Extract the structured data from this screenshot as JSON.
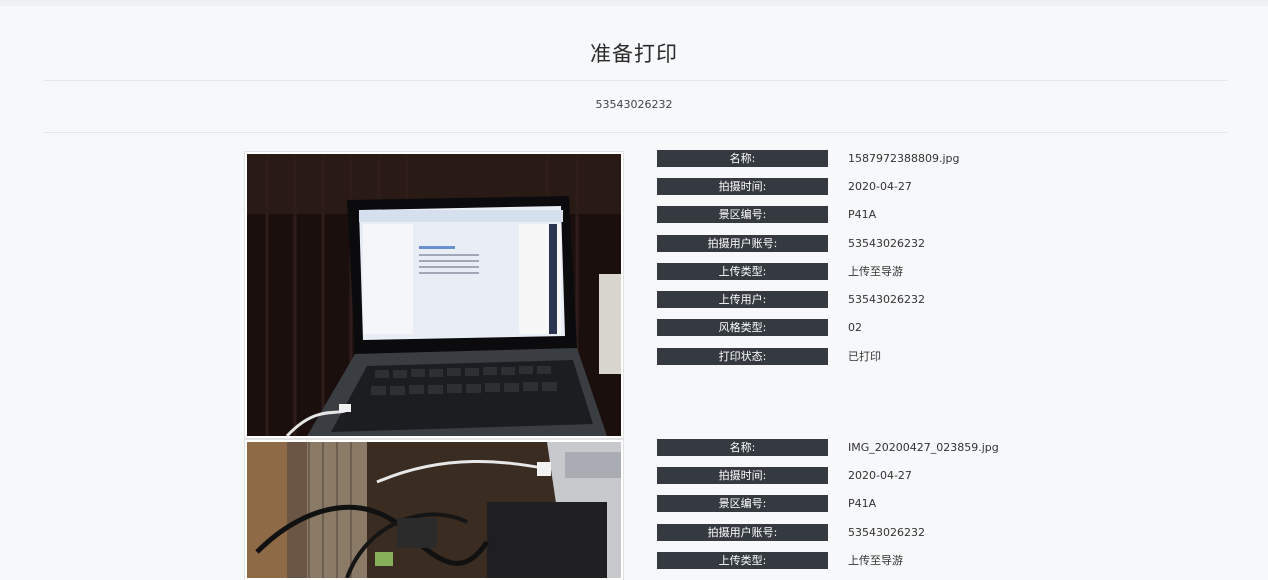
{
  "page": {
    "title": "准备打印",
    "subtitle": "53543026232"
  },
  "records": [
    {
      "fields": [
        {
          "label": "名称:",
          "value": "1587972388809.jpg"
        },
        {
          "label": "拍摄时间:",
          "value": "2020-04-27"
        },
        {
          "label": "景区编号:",
          "value": "P41A"
        },
        {
          "label": "拍摄用户账号:",
          "value": "53543026232"
        },
        {
          "label": "上传类型:",
          "value": "上传至导游"
        },
        {
          "label": "上传用户:",
          "value": "53543026232"
        },
        {
          "label": "风格类型:",
          "value": "02"
        },
        {
          "label": "打印状态:",
          "value": "已打印"
        }
      ]
    },
    {
      "fields": [
        {
          "label": "名称:",
          "value": "IMG_20200427_023859.jpg"
        },
        {
          "label": "拍摄时间:",
          "value": "2020-04-27"
        },
        {
          "label": "景区编号:",
          "value": "P41A"
        },
        {
          "label": "拍摄用户账号:",
          "value": "53543026232"
        },
        {
          "label": "上传类型:",
          "value": "上传至导游"
        }
      ]
    }
  ]
}
